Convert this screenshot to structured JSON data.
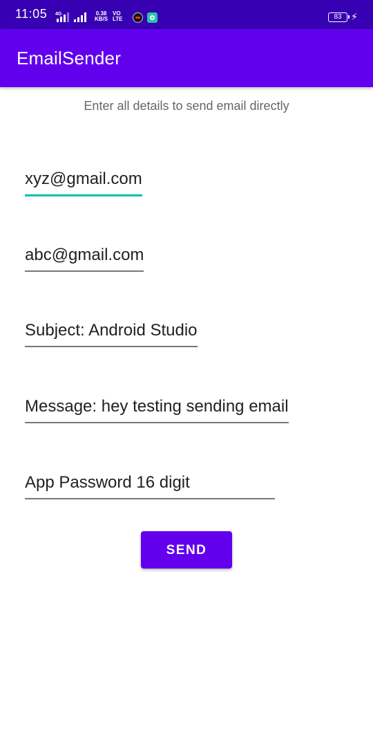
{
  "status_bar": {
    "time": "11:05",
    "network_type": "4G",
    "speed_value": "0.38",
    "speed_unit": "KB/S",
    "volte_top": "VO",
    "volte_bottom": "LTE",
    "battery_level": "83",
    "charging_icon": "⚡"
  },
  "app_bar": {
    "title": "EmailSender",
    "color": "#6200ee"
  },
  "subtitle": "Enter all details to send email directly",
  "form": {
    "from_email": "xyz@gmail.com",
    "to_email": "abc@gmail.com",
    "subject": "Subject: Android Studio",
    "message": "Message: hey testing sending email",
    "app_password": "App Password 16 digit"
  },
  "send_button": {
    "label": "SEND",
    "color": "#6200ee"
  },
  "accent_color": "#00bfae"
}
